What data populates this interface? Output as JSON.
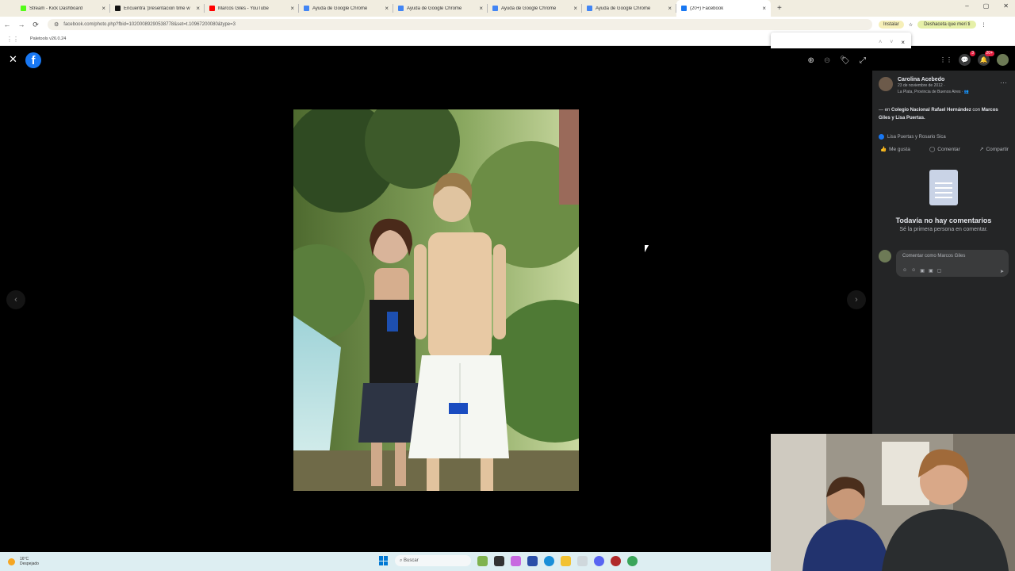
{
  "browser": {
    "tabs": [
      {
        "title": "Stream - Kick Dashboard",
        "color": "#53fc18",
        "active": false
      },
      {
        "title": "Encuentra 'presentacion time w",
        "color": "#111111",
        "active": false
      },
      {
        "title": "Marcos Giles - YouTube",
        "color": "#ff0000",
        "active": false
      },
      {
        "title": "Ayuda de Google Chrome",
        "color": "#4285f4",
        "active": false
      },
      {
        "title": "Ayuda de Google Chrome",
        "color": "#4285f4",
        "active": false
      },
      {
        "title": "Ayuda de Google Chrome",
        "color": "#4285f4",
        "active": false
      },
      {
        "title": "Ayuda de Google Chrome",
        "color": "#4285f4",
        "active": false
      },
      {
        "title": "(20+) Facebook",
        "color": "#1877f2",
        "active": true
      }
    ],
    "url": "facebook.com/photo.php?fbid=10200089290538778&set=t.10967200080&type=3",
    "install_label": "Instalar",
    "profile_label": "Deshaceta que meri ti",
    "bookmark": "Paletools v26.0.24",
    "tab_close_glyph": "×",
    "newtab_glyph": "+",
    "window_controls": [
      "–",
      "▢",
      "✕"
    ],
    "nav": {
      "back": "←",
      "forward": "→",
      "reload": "⟳"
    }
  },
  "find": {
    "up": "˄",
    "down": "˅",
    "close": "×"
  },
  "viewer": {
    "close_glyph": "✕",
    "logo_letter": "f",
    "tools": [
      "⊕",
      "⊖",
      "🏷",
      "⤢"
    ],
    "prev": "‹",
    "next": "›"
  },
  "fb_topnav": {
    "icons": [
      "⋮⋮",
      "💬",
      "🔔",
      ""
    ],
    "messenger_badge": "3",
    "notif_badge": "20+"
  },
  "post": {
    "author": "Carolina Acebedo",
    "date": "23 de noviembre de 2012 ·",
    "place": "La Plata, Provincia de Buenos Aires · 👥",
    "more": "···",
    "caption_prefix": "— en ",
    "caption_place": "Colegio Nacional Rafael Hernández",
    "caption_mid": " con ",
    "caption_people": "Marcos Giles y Lisa Puertas.",
    "reactions": "Lisa Puertas y Rosario Sica",
    "actions": {
      "like": "Me gusta",
      "comment": "Comentar",
      "share": "Compartir"
    },
    "action_icons": {
      "like": "👍",
      "comment": "◯",
      "share": "↗"
    },
    "empty_title": "Todavía no hay comentarios",
    "empty_sub": "Sé la primera persona en comentar.",
    "comment_placeholder": "Comentar como Marcos Giles",
    "comment_icons": [
      "☺",
      "☺",
      "▣",
      "▣",
      "▢"
    ],
    "send_glyph": "➤"
  },
  "taskbar": {
    "temperature": "16°C",
    "weather": "Despejado",
    "search": "Buscar"
  }
}
